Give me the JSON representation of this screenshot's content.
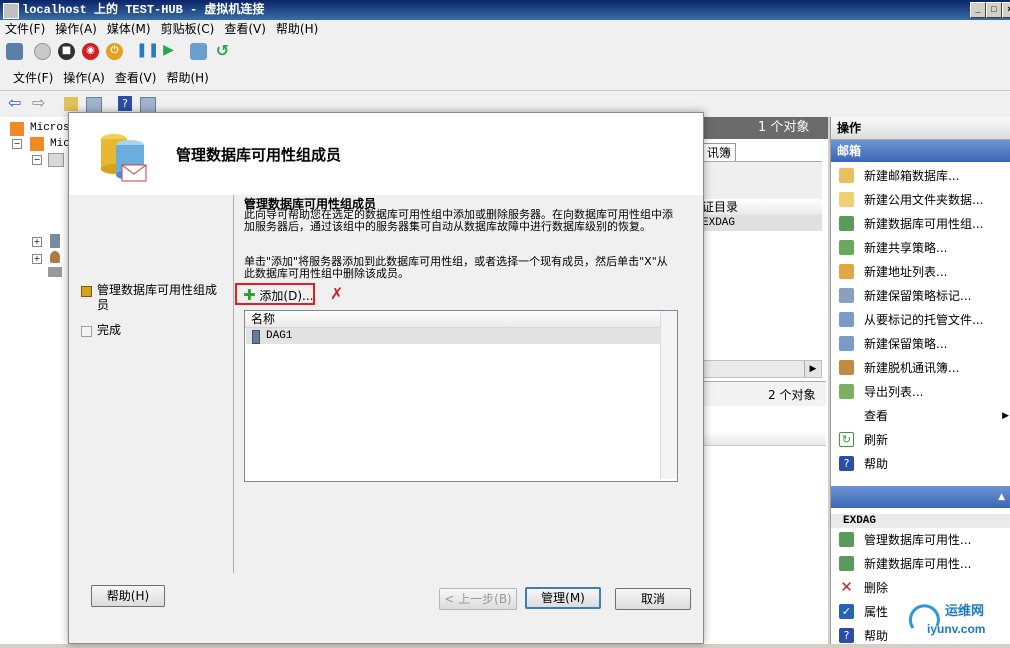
{
  "vm_window": {
    "title": "localhost 上的 TEST-HUB - 虚拟机连接",
    "menu": [
      "文件(F)",
      "操作(A)",
      "媒体(M)",
      "剪贴板(C)",
      "查看(V)",
      "帮助(H)"
    ]
  },
  "mmc": {
    "menu": [
      "文件(F)",
      "操作(A)",
      "查看(V)",
      "帮助(H)"
    ],
    "tree": {
      "root": "Micros",
      "child": "Mic"
    },
    "middle": {
      "count_top": "1 个对象",
      "tab_fragment": "讯簿",
      "column_fragment": "证目录",
      "row_fragment": "EXDAG",
      "count_bottom": "2 个对象"
    },
    "actions": {
      "title": "操作",
      "section_mailbox": "邮箱",
      "items": [
        "新建邮箱数据库...",
        "新建公用文件夹数据...",
        "新建数据库可用性组...",
        "新建共享策略...",
        "新建地址列表...",
        "新建保留策略标记...",
        "从要标记的托管文件...",
        "新建保留策略...",
        "新建脱机通讯簿...",
        "导出列表...",
        "查看",
        "刷新",
        "帮助"
      ],
      "section_exdag": "EXDAG",
      "exdag_items": [
        "管理数据库可用性...",
        "新建数据库可用性...",
        "删除",
        "属性",
        "帮助"
      ]
    }
  },
  "dialog": {
    "header_title": "管理数据库可用性组成员",
    "nav": {
      "step1": "管理数据库可用性组成员",
      "step2": "完成"
    },
    "content_title": "管理数据库可用性组成员",
    "description": "此向导可帮助您在选定的数据库可用性组中添加或删除服务器。在向数据库可用性组中添加服务器后，通过该组中的服务器集可自动从数据库故障中进行数据库级别的恢复。",
    "instruction": "单击\"添加\"将服务器添加到此数据库可用性组，或者选择一个现有成员，然后单击\"X\"从此数据库可用性组中删除该成员。",
    "add_button": "添加(D)...",
    "list_header": "名称",
    "list_rows": [
      "DAG1"
    ],
    "buttons": {
      "help": "帮助(H)",
      "back": "< 上一步(B)",
      "manage": "管理(M)",
      "cancel": "取消"
    }
  },
  "watermark": {
    "text": "运维网",
    "url": "iyunv.com"
  }
}
